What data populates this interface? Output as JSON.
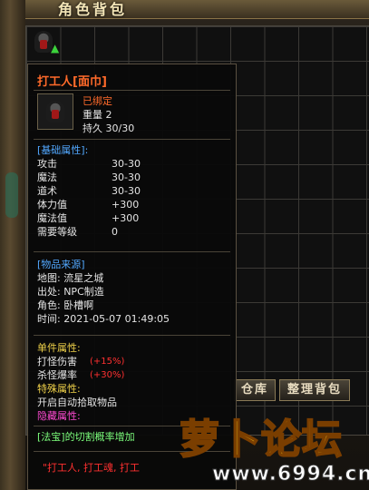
{
  "window": {
    "title": "角色背包"
  },
  "buttons": {
    "warehouse": "仓库",
    "sort": "整理背包"
  },
  "tooltip": {
    "name": "打工人[面巾]",
    "bound": "已绑定",
    "weight": "重量 2",
    "durability": "持久 30/30",
    "base_header": "[基础属性]:",
    "base_stats": [
      {
        "label": "攻击",
        "value": "30-30"
      },
      {
        "label": "魔法",
        "value": "30-30"
      },
      {
        "label": "道术",
        "value": "30-30"
      },
      {
        "label": "体力值",
        "value": "+300"
      },
      {
        "label": "魔法值",
        "value": "+300"
      },
      {
        "label": "需要等级",
        "value": "0"
      }
    ],
    "source_header": "[物品来源]",
    "source": {
      "map": "地图: 流星之城",
      "from": "出处: NPC制造",
      "role": "角色: 卧槽啊",
      "time": "时间: 2021-05-07 01:49:05"
    },
    "single_header": "单件属性:",
    "single_stats": [
      {
        "label": "打怪伤害",
        "value": "(+15%)"
      },
      {
        "label": "杀怪爆率",
        "value": "(+30%)"
      }
    ],
    "special_header": "特殊属性:",
    "special_text": "开启自动拾取物品",
    "hidden_header": "隐藏属性:",
    "magic_line": "[法宝]的切割概率增加",
    "slogan": "\"打工人, 打工魂, 打工"
  },
  "watermark": {
    "text": "萝卜论坛",
    "url": "www.6994.cn"
  }
}
